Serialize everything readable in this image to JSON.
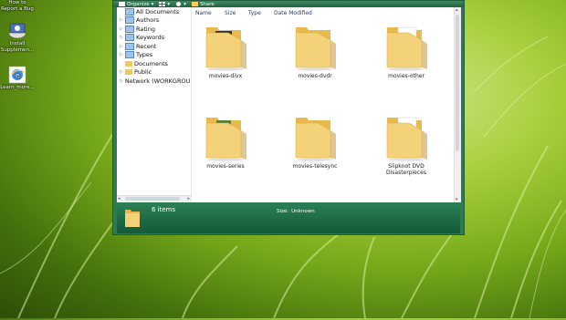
{
  "desktop": {
    "icons": [
      {
        "label_line1": "How to",
        "label_line2": "Report a Bug"
      },
      {
        "label_line1": "Install",
        "label_line2": "Supplemen..."
      },
      {
        "label_line1": "Learn_more...",
        "label_line2": ""
      }
    ]
  },
  "toolbar": {
    "organize_label": "Organize",
    "share_label": "Share"
  },
  "nav": {
    "items": [
      {
        "label": "All Documents",
        "icon": "search-folder-icon",
        "expandable": false
      },
      {
        "label": "Authors",
        "icon": "search-folder-icon",
        "expandable": true
      },
      {
        "label": "Rating",
        "icon": "search-folder-icon",
        "expandable": true
      },
      {
        "label": "Keywords",
        "icon": "search-folder-icon",
        "expandable": true
      },
      {
        "label": "Recent",
        "icon": "search-folder-icon",
        "expandable": true
      },
      {
        "label": "Types",
        "icon": "search-folder-icon",
        "expandable": true
      },
      {
        "label": "Documents",
        "icon": "folder-icon",
        "expandable": false
      },
      {
        "label": "Public",
        "icon": "folder-icon",
        "expandable": true
      },
      {
        "label": "Network (WORKGROUP",
        "icon": "network-icon",
        "expandable": true
      }
    ]
  },
  "columns": [
    "Name",
    "Size",
    "Type",
    "Date Modified"
  ],
  "folders": [
    {
      "name": "movies-divx",
      "preview": "film"
    },
    {
      "name": "movies-dvdr",
      "preview": "none"
    },
    {
      "name": "movies-other",
      "preview": "paper"
    },
    {
      "name": "movies-series",
      "preview": "photo"
    },
    {
      "name": "movies-telesync",
      "preview": "none"
    },
    {
      "name": "Slipknot DVD Disasterpieces",
      "preview": "disc"
    }
  ],
  "details": {
    "count_text": "6 items",
    "size_label": "Size:",
    "size_value": "Unknown"
  },
  "colors": {
    "window_chrome": "#2f7a53",
    "details_pane": "#145a36",
    "folder_yellow": "#f1cf6f"
  }
}
